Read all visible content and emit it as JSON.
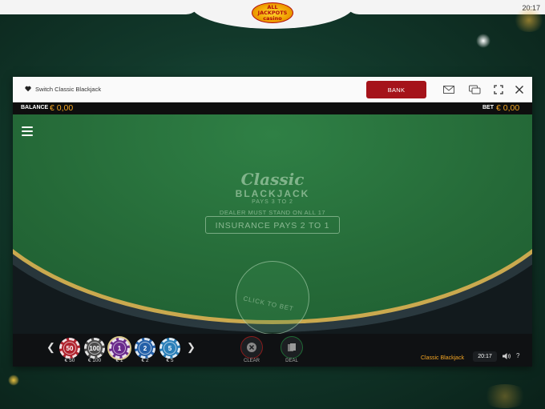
{
  "site": {
    "logo_line1": "ALL",
    "logo_line2": "JACKPOTS",
    "logo_line3": "casino",
    "clock": "20:17"
  },
  "window": {
    "title": "Switch Classic Blackjack",
    "bank_label": "BANK",
    "icons": [
      "heart-icon",
      "mail-icon",
      "chat-icon",
      "fullscreen-icon",
      "close-icon"
    ]
  },
  "info_bar": {
    "balance_label": "BALANCE",
    "balance_value": "€ 0,00",
    "bet_label": "BET",
    "bet_value": "€ 0,00"
  },
  "table": {
    "title_script": "Classic",
    "title_main": "BLACKJACK",
    "pays": "PAYS 3 TO 2",
    "dealer_rule": "DEALER MUST STAND ON ALL 17",
    "insurance": "INSURANCE PAYS 2 TO 1",
    "bet_spot": "CLICK TO BET",
    "colors": {
      "felt": "#256a38",
      "rail_gold": "#caa94f"
    }
  },
  "chips": [
    {
      "value": "50",
      "label": "€ 50",
      "color": "#b0232e"
    },
    {
      "value": "100",
      "label": "€ 100",
      "color": "#4a4a4a"
    },
    {
      "value": "1",
      "label": "€ 1",
      "color": "#6a2a8c",
      "selected": true
    },
    {
      "value": "2",
      "label": "€ 2",
      "color": "#2460a8"
    },
    {
      "value": "5",
      "label": "€ 5",
      "color": "#2a7fb8"
    }
  ],
  "controls": {
    "prev_arrow": "❮",
    "next_arrow": "❯",
    "clear_label": "CLEAR",
    "deal_label": "DEAL",
    "game_name": "Classic Blackjack",
    "clock": "20:17",
    "help": "?"
  }
}
